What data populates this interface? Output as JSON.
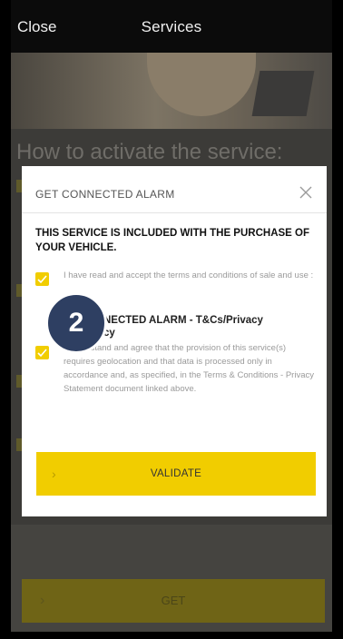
{
  "topbar": {
    "close_label": "Close",
    "title": "Services"
  },
  "background": {
    "headline": "How to activate the service:",
    "get_button": "GET"
  },
  "modal": {
    "header": "GET CONNECTED ALARM",
    "included_text": "THIS SERVICE IS INCLUDED WITH THE PURCHASE OF YOUR VEHICLE.",
    "terms_text": "I have read and accept the terms and conditions of sale and use :",
    "section_title": "NECTED ALARM - T&Cs/Privacy",
    "section_title_line2": "cy",
    "consent_text": "I understand and agree that the provision of this service(s) requires geolocation and that data is processed only in accordance and, as specified, in the Terms & Conditions - Privacy Statement document linked above.",
    "validate_label": "VALIDATE",
    "checkbox_1_checked": true,
    "checkbox_2_checked": true
  },
  "badge": {
    "number": "2"
  },
  "colors": {
    "accent_yellow": "#f1cd00",
    "badge_navy": "#2e3f62",
    "topbar_bg": "#0b0b0b"
  }
}
